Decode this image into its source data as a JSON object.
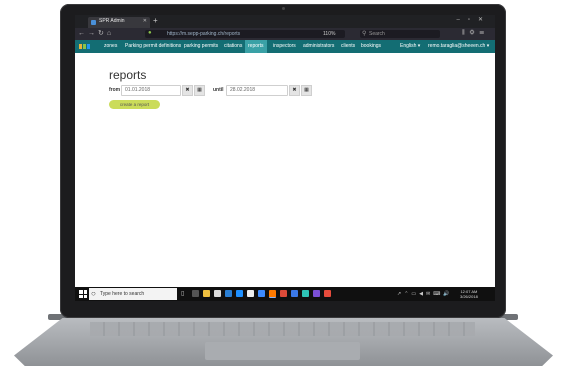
{
  "browser": {
    "tab_title": "SPR Admin",
    "url": "https://m.sepp-parking.ch/reports",
    "zoom": "110%",
    "search_placeholder": "Search"
  },
  "nav": {
    "items": [
      "zones",
      "Parking permit definitions",
      "parking permits",
      "citations",
      "reports",
      "inspectors",
      "administrators",
      "clients",
      "bookings"
    ],
    "active": "reports",
    "language": "English ▾",
    "user": "remo.taraglia@sheeen.ch ▾"
  },
  "page": {
    "title": "reports",
    "from_label": "from",
    "from_value": "01.01.2018",
    "until_label": "until",
    "until_value": "28.02.2018",
    "create_button": "create a report"
  },
  "taskbar": {
    "search_text": "Type here to search",
    "time": "12:07 AM",
    "date": "3/26/2018"
  },
  "colors": {
    "nav_bg": "#136d73",
    "nav_active": "#3aa1a6",
    "create_button": "#cbdc5a"
  },
  "icons": {
    "clear": "✖",
    "calendar": "▦"
  }
}
